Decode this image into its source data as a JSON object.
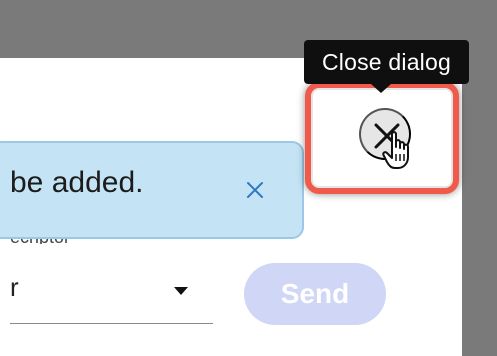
{
  "tooltip": {
    "text": "Close dialog"
  },
  "dialog": {
    "close_icon": "close-icon",
    "close_tooltip_target": "Close dialog"
  },
  "toast": {
    "message": "be added.",
    "dismiss_icon": "close-icon"
  },
  "form": {
    "field_label": "ecriptor",
    "select_value": "r",
    "send_label": "Send"
  },
  "colors": {
    "backdrop": "#7a7a7a",
    "tooltip_bg": "#0f0f0f",
    "highlight_border": "#f05a4a",
    "toast_bg": "#c4e4f5",
    "toast_border": "#9cc8e5",
    "send_bg": "#cfd6f6",
    "toast_icon": "#2f78c4"
  }
}
